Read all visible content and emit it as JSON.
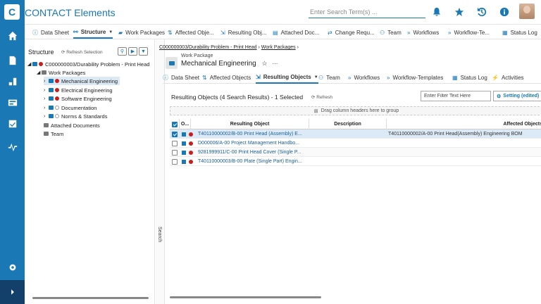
{
  "app": {
    "title": "CONTACT Elements",
    "search_placeholder": "Enter Search Term(s) ..."
  },
  "top_tabs": [
    {
      "label": "Data Sheet",
      "icon": "info-icon"
    },
    {
      "label": "Structure",
      "icon": "structure-icon",
      "active": true
    },
    {
      "label": "Work Packages",
      "icon": "folder-icon"
    },
    {
      "label": "Affected Obje...",
      "icon": "affected-icon"
    },
    {
      "label": "Resulting Obj...",
      "icon": "resulting-icon"
    },
    {
      "label": "Attached Doc...",
      "icon": "doc-icon"
    },
    {
      "label": "Change Requ...",
      "icon": "change-icon"
    },
    {
      "label": "Team",
      "icon": "team-icon"
    },
    {
      "label": "Workflows",
      "icon": "workflow-icon"
    },
    {
      "label": "Workflow-Te...",
      "icon": "workflow-template-icon"
    },
    {
      "label": "Status Log",
      "icon": "status-log-icon"
    }
  ],
  "structure": {
    "title": "Structure",
    "refresh_label": "Refresh Selection",
    "root": "C000000003/Durability Problem - Print Head",
    "work_packages_label": "Work Packages",
    "items": [
      {
        "label": "Mechanical Engineering",
        "status": "red",
        "selected": true
      },
      {
        "label": "Electrical Engineering",
        "status": "red"
      },
      {
        "label": "Software Engineering",
        "status": "red"
      },
      {
        "label": "Documentation",
        "status": "empty"
      },
      {
        "label": "Norms & Standards",
        "status": "empty"
      }
    ],
    "attached_documents": "Attached Documents",
    "team": "Team"
  },
  "search_strip": "Search",
  "breadcrumb": {
    "root": "C000000003/Durability Problem - Print Head",
    "sep": "›",
    "current": "Work Packages",
    "tail": "›"
  },
  "work_package": {
    "type": "Work Package",
    "name": "Mechanical Engineering",
    "star": "☆",
    "more": "···"
  },
  "detail_tabs": [
    {
      "label": "Data Sheet",
      "icon": "info-icon"
    },
    {
      "label": "Affected Objects",
      "icon": "affected-icon"
    },
    {
      "label": "Resulting Objects",
      "icon": "resulting-icon",
      "active": true
    },
    {
      "label": "Team",
      "icon": "team-icon"
    },
    {
      "label": "Workflows",
      "icon": "workflow-icon"
    },
    {
      "label": "Workflow-Templates",
      "icon": "workflow-template-icon"
    },
    {
      "label": "Status Log",
      "icon": "status-log-icon"
    },
    {
      "label": "Activities",
      "icon": "activities-icon"
    }
  ],
  "results": {
    "title": "Resulting Objects (4 Search Results) - 1 Selected",
    "refresh_label": "Refresh",
    "filter_placeholder": "Enter Filter Text Here",
    "setting_label": "Setting (edited)",
    "group_hint": "Drag column headers here to group",
    "columns": {
      "o": "O...",
      "resulting": "Resulting Object",
      "description": "Description",
      "affected": "Affected Objects"
    },
    "rows": [
      {
        "resulting": "T40110000002/B-00 Print Head (Assembly) E...",
        "description": "",
        "affected": "T40110000002/A-00 Print Head(Assembly) Engineering BOM",
        "selected": true
      },
      {
        "resulting": "D000006/A-00 Project Management Handbo...",
        "description": "",
        "affected": ""
      },
      {
        "resulting": "9281999911/C-00 Print Head Cover (Single P...",
        "description": "",
        "affected": ""
      },
      {
        "resulting": "T40110000003/B-00 Plate (Single Part) Engin...",
        "description": "",
        "affected": ""
      }
    ]
  }
}
